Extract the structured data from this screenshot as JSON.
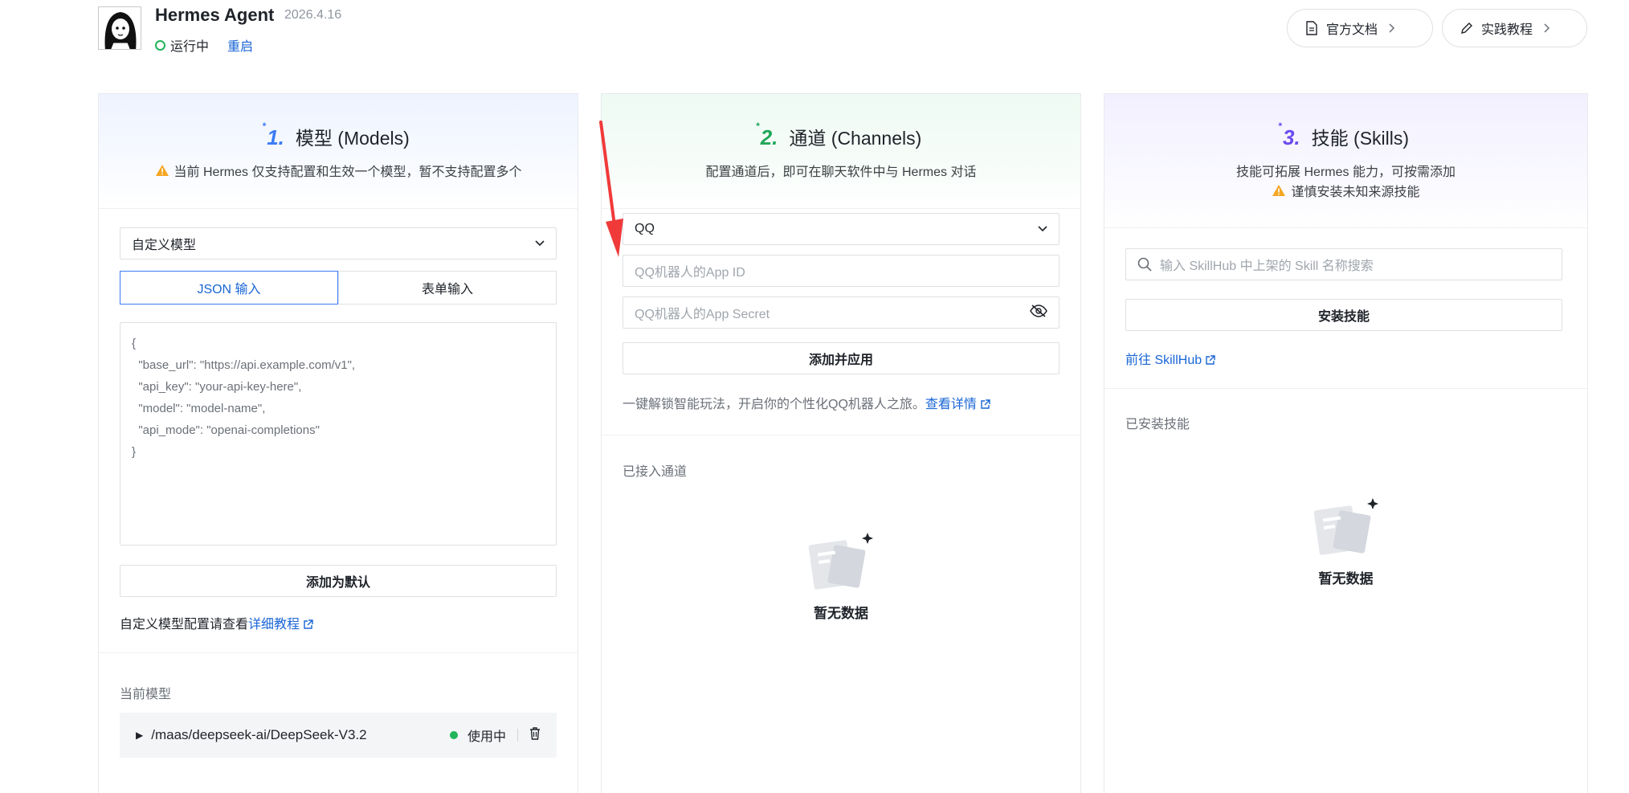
{
  "header": {
    "app_name": "Hermes Agent",
    "version": "2026.4.16",
    "status": "运行中",
    "restart_label": "重启",
    "docs_label": "官方文档",
    "tutorial_label": "实践教程"
  },
  "models": {
    "step": "1.",
    "title": "模型 (Models)",
    "notice": "当前 Hermes 仅支持配置和生效一个模型，暂不支持配置多个",
    "select_value": "自定义模型",
    "tabs": [
      {
        "label": "JSON 输入",
        "active": true
      },
      {
        "label": "表单输入",
        "active": false
      }
    ],
    "json_text": "{\n  \"base_url\": \"https://api.example.com/v1\",\n  \"api_key\": \"your-api-key-here\",\n  \"model\": \"model-name\",\n  \"api_mode\": \"openai-completions\"\n}",
    "add_default_label": "添加为默认",
    "help_prefix": "自定义模型配置请查看",
    "help_link": "详细教程",
    "current_label": "当前模型",
    "current_model": "/maas/deepseek-ai/DeepSeek-V3.2",
    "in_use_label": "使用中"
  },
  "channels": {
    "step": "2.",
    "title": "通道 (Channels)",
    "notice": "配置通道后，即可在聊天软件中与 Hermes 对话",
    "select_value": "QQ",
    "app_id_placeholder": "QQ机器人的App ID",
    "app_secret_placeholder": "QQ机器人的App Secret",
    "add_apply_label": "添加并应用",
    "promo_text": "一键解锁智能玩法，开启你的个性化QQ机器人之旅。",
    "promo_link": "查看详情",
    "connected_label": "已接入通道",
    "empty_text": "暂无数据"
  },
  "skills": {
    "step": "3.",
    "title": "技能 (Skills)",
    "notice": "技能可拓展 Hermes 能力，可按需添加",
    "warning": "谨慎安装未知来源技能",
    "search_placeholder": "输入 SkillHub 中上架的 Skill 名称搜索",
    "install_label": "安装技能",
    "skillhub_link": "前往 SkillHub",
    "installed_label": "已安装技能",
    "empty_text": "暂无数据"
  },
  "colors": {
    "accent": "#1a66d6",
    "status_green": "#22b45a",
    "warning": "#f5a623",
    "annotation_red": "#f03a3a"
  }
}
